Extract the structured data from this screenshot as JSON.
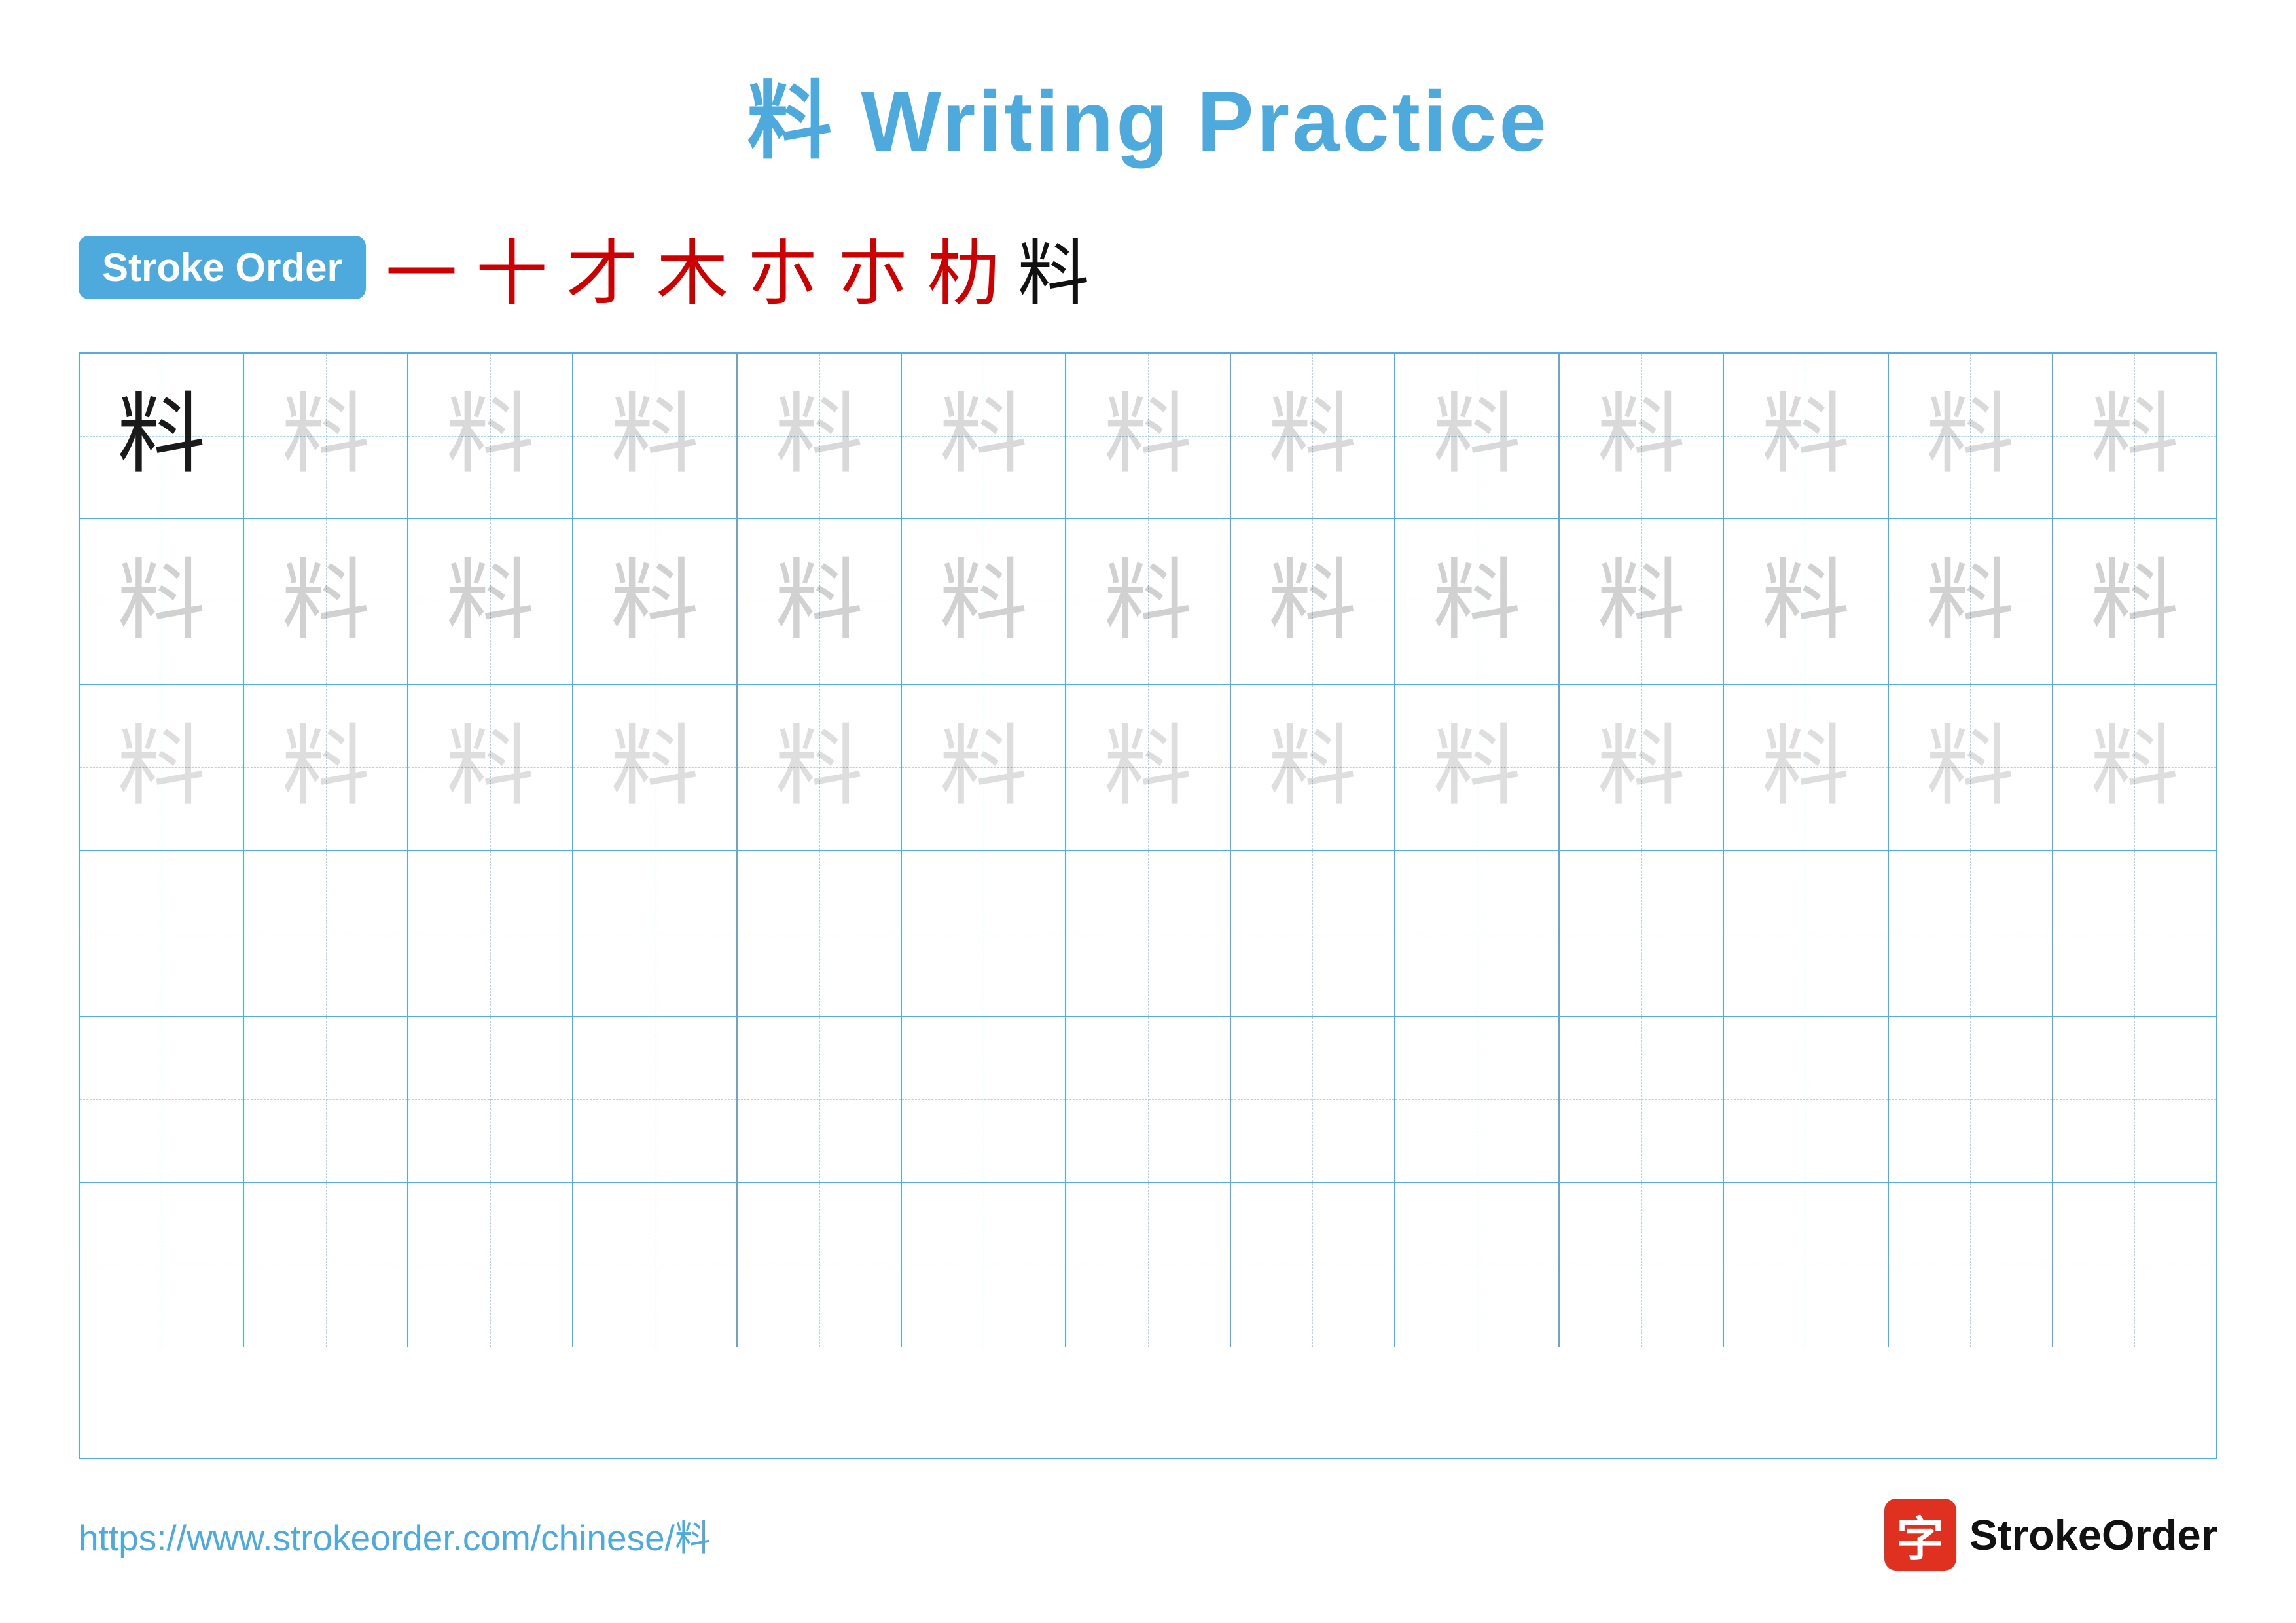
{
  "title": {
    "chinese_char": "料",
    "text": " Writing Practice"
  },
  "stroke_order": {
    "badge_label": "Stroke Order",
    "strokes": [
      "一",
      "十",
      "才",
      "木",
      "朩",
      "朩",
      "朸",
      "料"
    ]
  },
  "grid": {
    "rows": 6,
    "cols": 13,
    "char": "料",
    "row_styles": [
      "solid-then-faint",
      "faint",
      "faint",
      "empty",
      "empty",
      "empty"
    ]
  },
  "footer": {
    "url": "https://www.strokeorder.com/chinese/料",
    "logo_char": "字",
    "logo_text": "StrokeOrder"
  }
}
